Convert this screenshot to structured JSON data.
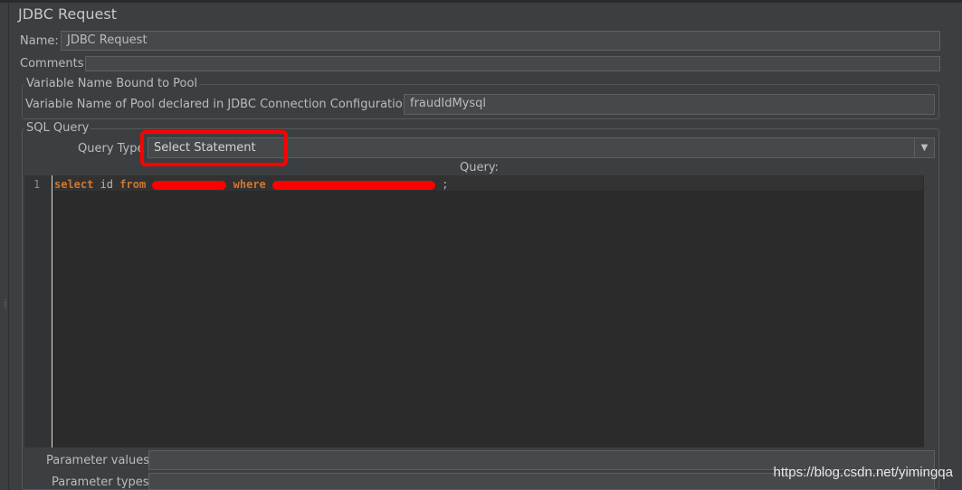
{
  "panel": {
    "title": "JDBC Request"
  },
  "name_row": {
    "label": "Name:",
    "value": "JDBC Request"
  },
  "comments_row": {
    "label": "Comments:",
    "value": ""
  },
  "pool_section": {
    "legend": "Variable Name Bound to Pool",
    "label": "Variable Name of Pool declared in JDBC Connection Configuration:",
    "value": "fraudIdMysql"
  },
  "sql_section": {
    "legend": "SQL Query",
    "query_type_label": "Query Type",
    "query_type_value": "Select Statement",
    "query_label": "Query:",
    "line_number": "1",
    "code": {
      "kw_select": "select",
      "id_text": " id ",
      "kw_from": "from",
      "kw_where": "where",
      "semicolon": " ;"
    }
  },
  "params": {
    "values_label": "Parameter values:",
    "values_value": "",
    "types_label": "Parameter types:",
    "types_value": ""
  },
  "watermark": "https://blog.csdn.net/yimingqa",
  "colors": {
    "background": "#3c3f41",
    "editor_bg": "#2b2b2b",
    "keyword": "#cc7832",
    "highlight_box": "#ff0000"
  },
  "icons": {
    "dropdown": "chevron-down-icon"
  }
}
